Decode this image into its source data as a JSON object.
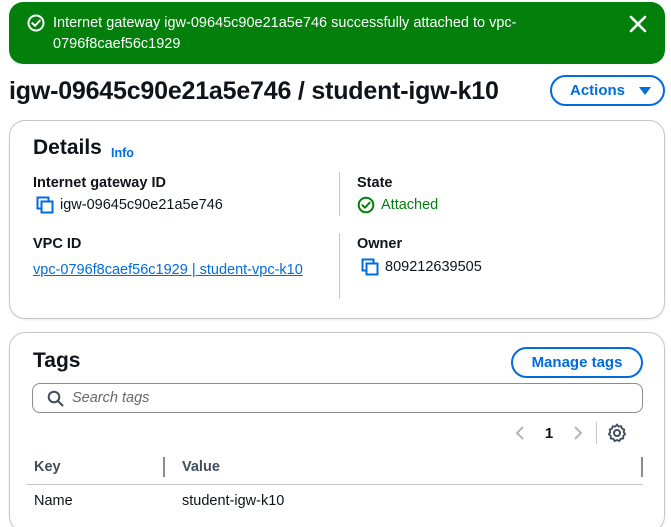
{
  "flash": {
    "message": "Internet gateway igw-09645c90e21a5e746 successfully attached to vpc-0796f8caef56c1929",
    "type": "success"
  },
  "header": {
    "title": "igw-09645c90e21a5e746 / student-igw-k10",
    "actions_label": "Actions"
  },
  "details": {
    "title": "Details",
    "info_label": "Info",
    "igw_id_label": "Internet gateway ID",
    "igw_id_value": "igw-09645c90e21a5e746",
    "state_label": "State",
    "state_value": "Attached",
    "vpc_id_label": "VPC ID",
    "vpc_id_value": "vpc-0796f8caef56c1929 | student-vpc-k10",
    "owner_label": "Owner",
    "owner_value": "809212639505"
  },
  "tags": {
    "title": "Tags",
    "manage_label": "Manage tags",
    "search_placeholder": "Search tags",
    "page_number": "1",
    "columns": [
      "Key",
      "Value"
    ],
    "rows": [
      {
        "key": "Name",
        "value": "student-igw-k10"
      }
    ]
  },
  "colors": {
    "success": "#037f0c",
    "link": "#006ce0",
    "border": "#c6c6cd"
  }
}
